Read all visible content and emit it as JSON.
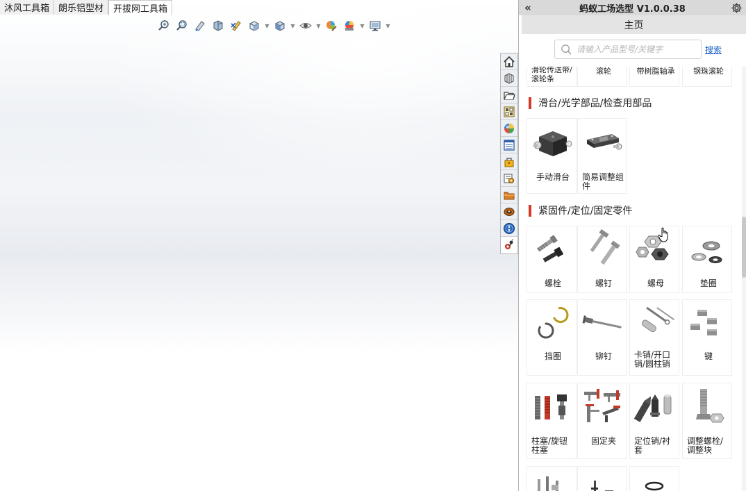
{
  "doc_tabs": [
    {
      "label": "沐风工具箱",
      "active": false
    },
    {
      "label": "朗乐铝型材",
      "active": false
    },
    {
      "label": "开拔网工具箱",
      "active": true
    }
  ],
  "heads_up_toolbar": [
    {
      "icon": "zoom-to-fit-icon",
      "dropdown": false
    },
    {
      "icon": "zoom-to-area-icon",
      "dropdown": false
    },
    {
      "icon": "previous-view-icon",
      "dropdown": false
    },
    {
      "icon": "section-view-icon",
      "dropdown": false
    },
    {
      "icon": "dynamic-annotation-icon",
      "dropdown": false
    },
    {
      "icon": "view-orientation-icon",
      "dropdown": true
    },
    {
      "icon": "display-style-icon",
      "dropdown": true
    },
    {
      "icon": "hide-show-items-icon",
      "dropdown": true
    },
    {
      "icon": "edit-appearance-icon",
      "dropdown": false
    },
    {
      "icon": "apply-scene-icon",
      "dropdown": true
    },
    {
      "icon": "view-settings-icon",
      "dropdown": true
    }
  ],
  "taskpane_tabs": [
    "solidworks-resources-icon",
    "design-library-icon",
    "file-explorer-icon",
    "view-palette-icon",
    "appearances-icon",
    "custom-properties-icon",
    "toolbox-icon",
    "engineering-tool-icon",
    "folder-tool-icon",
    "bearing-tool-icon",
    "navigation-tool-icon",
    "ant-factory-icon"
  ],
  "panel": {
    "title": "蚂蚁工场选型 V1.0.0.38",
    "collapse_symbol": "«",
    "home_label": "主页",
    "search_placeholder": "请输入产品型号/关键字",
    "search_value": "",
    "search_button": "搜索"
  },
  "partial_row_labels": [
    "滑轮传送带/滚轮条",
    "滚轮",
    "带树脂轴承",
    "钢珠滚轮"
  ],
  "sections": [
    {
      "title": "滑台/光学部品/检查用部品",
      "items": [
        {
          "label": "手动滑台",
          "icon": "manual-slide-icon"
        },
        {
          "label": "简易调整组件",
          "icon": "adjust-unit-icon"
        }
      ]
    },
    {
      "title": "紧固件/定位/固定零件",
      "items": [
        {
          "label": "螺栓",
          "icon": "bolt-icon"
        },
        {
          "label": "螺钉",
          "icon": "screw-icon"
        },
        {
          "label": "螺母",
          "icon": "nut-icon"
        },
        {
          "label": "垫圈",
          "icon": "washer-icon"
        },
        {
          "label": "挡圈",
          "icon": "retaining-ring-icon"
        },
        {
          "label": "铆钉",
          "icon": "rivet-icon"
        },
        {
          "label": "卡销/开口销/圆柱销",
          "icon": "pin-icon"
        },
        {
          "label": "键",
          "icon": "key-icon"
        },
        {
          "label": "柱塞/旋钮柱塞",
          "icon": "plunger-icon"
        },
        {
          "label": "固定夹",
          "icon": "clamp-icon"
        },
        {
          "label": "定位销/衬套",
          "icon": "locating-pin-icon"
        },
        {
          "label": "调整螺栓/调整块",
          "icon": "adjust-bolt-icon"
        }
      ]
    }
  ],
  "colors": {
    "section_bar": "#d43a27",
    "search_link": "#1a5fc9",
    "panel_title_bg": "#d9d9d9",
    "home_bar_bg": "#e4e4e4"
  }
}
